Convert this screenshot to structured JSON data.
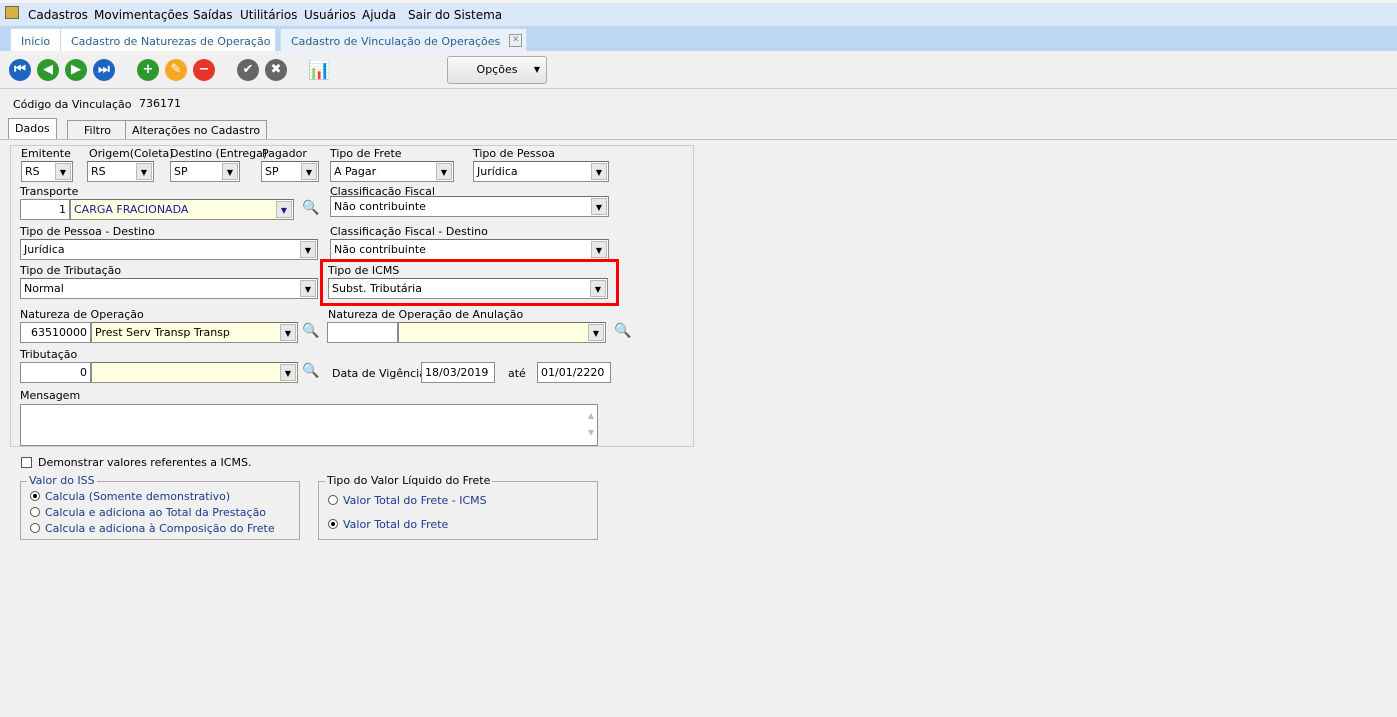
{
  "menu": [
    "Cadastros",
    "Movimentações",
    "Saídas",
    "Utilitários",
    "Usuários",
    "Ajuda",
    "Sair do Sistema"
  ],
  "doc_tabs": [
    "Início",
    "Cadastro de Naturezas de Operação",
    "Cadastro de Vinculação de Operações"
  ],
  "toolbar": {
    "options": "Opções"
  },
  "codigo": {
    "label": "Código da Vinculação",
    "value": "736171"
  },
  "form_tabs": [
    "Dados",
    "Filtro",
    "Alterações no Cadastro"
  ],
  "fields": {
    "emitente": {
      "label": "Emitente",
      "value": "RS"
    },
    "origem": {
      "label": "Origem(Coleta)",
      "value": "RS"
    },
    "destino": {
      "label": "Destino (Entrega)",
      "value": "SP"
    },
    "pagador": {
      "label": "Pagador",
      "value": "SP"
    },
    "tipo_frete": {
      "label": "Tipo de Frete",
      "value": "A Pagar"
    },
    "tipo_pessoa": {
      "label": "Tipo de Pessoa",
      "value": "Jurídica"
    },
    "transporte": {
      "label": "Transporte",
      "code": "1",
      "value": "CARGA FRACIONADA"
    },
    "class_fiscal": {
      "label": "Classificação Fiscal",
      "value": "Não contribuinte"
    },
    "tipo_pessoa_dest": {
      "label": "Tipo de Pessoa - Destino",
      "value": "Jurídica"
    },
    "class_fiscal_dest": {
      "label": "Classificação Fiscal - Destino",
      "value": "Não contribuinte"
    },
    "tipo_tributacao": {
      "label": "Tipo de Tributação",
      "value": "Normal"
    },
    "tipo_icms": {
      "label": "Tipo de ICMS",
      "value": "Subst. Tributária"
    },
    "natureza": {
      "label": "Natureza de Operação",
      "code": "63510000",
      "value": "Prest  Serv Transp Transp"
    },
    "natureza_anul": {
      "label": "Natureza de Operação de Anulação",
      "code": "",
      "value": ""
    },
    "tributacao": {
      "label": "Tributação",
      "code": "0",
      "value": ""
    },
    "vigencia": {
      "label": "Data de Vigência",
      "from": "18/03/2019",
      "to_label": "até",
      "to": "01/01/2220"
    },
    "mensagem": {
      "label": "Mensagem",
      "value": ""
    }
  },
  "demonstrar": "Demonstrar valores referentes a ICMS.",
  "iss": {
    "title": "Valor do ISS",
    "options": [
      "Calcula (Somente demonstrativo)",
      "Calcula e adiciona ao Total da Prestação",
      "Calcula e adiciona à Composição do Frete"
    ]
  },
  "liquido": {
    "title": "Tipo do Valor Líquido do Frete",
    "options": [
      "Valor Total do Frete - ICMS",
      "Valor Total do Frete"
    ]
  }
}
